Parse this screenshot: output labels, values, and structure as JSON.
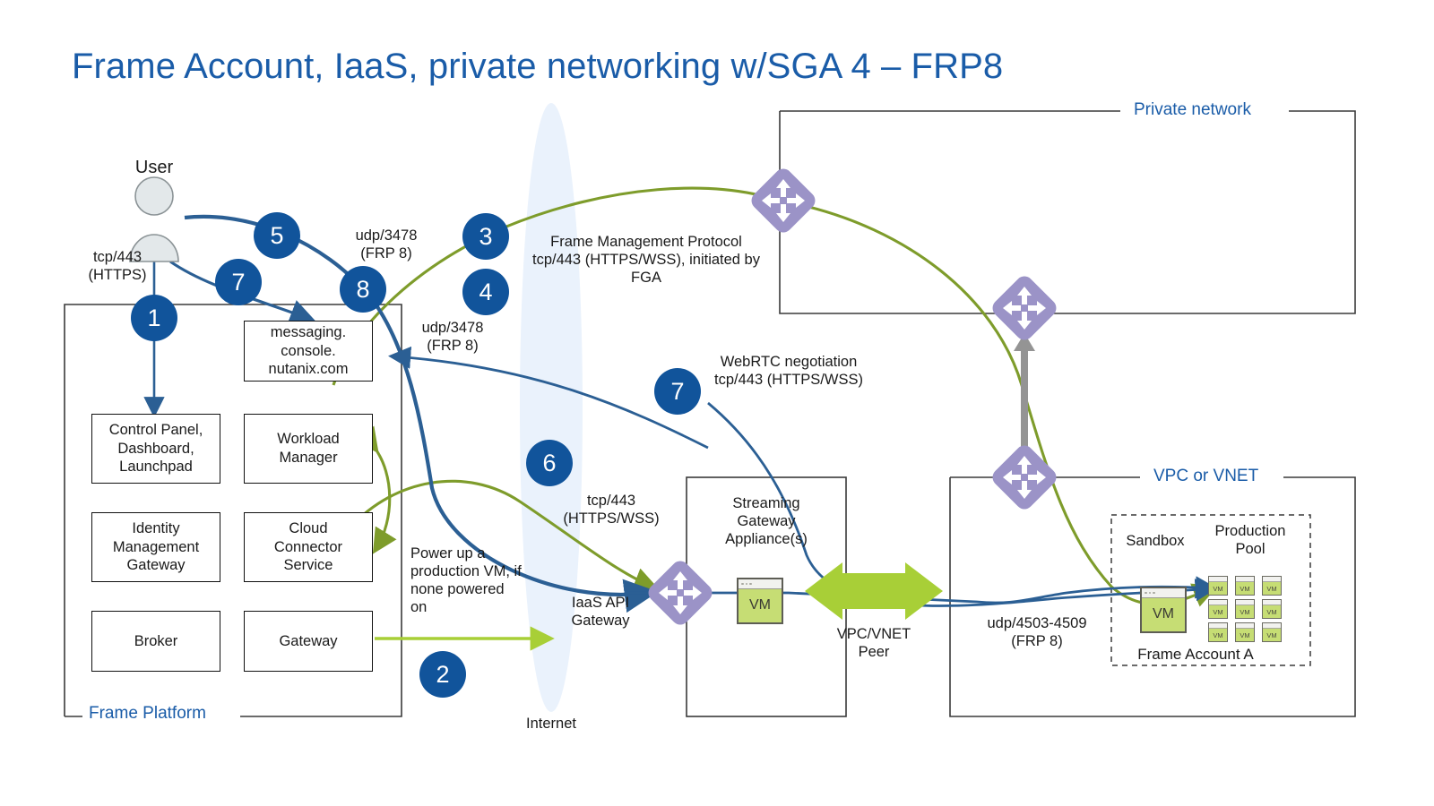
{
  "title": "Frame Account, IaaS, private networking w/SGA 4 – FRP8",
  "zones": {
    "frame_platform": "Frame Platform",
    "private_network": "Private network",
    "vpc_vnet": "VPC or VNET",
    "internet": "Internet"
  },
  "actors": {
    "user": "User"
  },
  "boxes": {
    "messaging": "messaging.\nconsole.\nnutanix.com",
    "control_panel": "Control Panel,\nDashboard,\nLaunchpad",
    "workload_manager": "Workload\nManager",
    "identity_mgmt": "Identity\nManagement\nGateway",
    "cloud_connector": "Cloud\nConnector\nService",
    "broker": "Broker",
    "gateway": "Gateway",
    "streaming_gateway": "Streaming\nGateway\nAppliance(s)",
    "iaas_api_gateway": "IaaS API\nGateway"
  },
  "account": {
    "frame_account": "Frame Account A",
    "sandbox": "Sandbox",
    "production_pool": "Production\nPool",
    "sandbox_vm_label": "VM",
    "pool_vm_label": "VM",
    "pool_vm_count": 9
  },
  "annotations": {
    "tcp443_https": "tcp/443\n(HTTPS)",
    "udp3478_top": "udp/3478\n(FRP 8)",
    "udp3478_mid": "udp/3478\n(FRP 8)",
    "frame_mgmt_protocol": "Frame Management Protocol\ntcp/443 (HTTPS/WSS), initiated by\nFGA",
    "webrtc": "WebRTC negotiation\ntcp/443 (HTTPS/WSS)",
    "tcp443_wss": "tcp/443\n(HTTPS/WSS)",
    "power_up": "Power up a\nproduction VM, if\nnone powered\non",
    "vpc_vnet_peer": "VPC/VNET\nPeer",
    "udp4503": "udp/4503-4509\n(FRP 8)"
  },
  "steps": [
    {
      "n": "1"
    },
    {
      "n": "2"
    },
    {
      "n": "3"
    },
    {
      "n": "4"
    },
    {
      "n": "5"
    },
    {
      "n": "6"
    },
    {
      "n": "7"
    },
    {
      "n": "7"
    },
    {
      "n": "8"
    }
  ],
  "step_labels": {
    "s1": "1",
    "s2": "2",
    "s3": "3",
    "s4": "4",
    "s5": "5",
    "s6": "6",
    "s7a": "7",
    "s7b": "7",
    "s8": "8"
  },
  "icons": {
    "router": "router-icon",
    "user": "user-avatar-icon",
    "vm": "vm-icon"
  },
  "colors": {
    "brand_blue": "#1a5ca8",
    "step_blue": "#11549b",
    "flow_blue": "#2b5f94",
    "flow_green": "#7e9c2b",
    "bright_green": "#a8cf37",
    "router_purple": "#9b93c7",
    "vm_green": "#c6dd74",
    "internet_fill": "#eaf2fc",
    "gray_arrow": "#949494"
  }
}
